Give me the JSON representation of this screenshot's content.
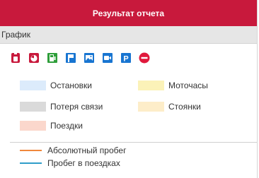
{
  "header": {
    "title": "Результат отчета"
  },
  "section": {
    "title": "График"
  },
  "toolbar": {
    "buttons": [
      {
        "icon": "fuel-canister-icon"
      },
      {
        "icon": "speedometer-icon"
      },
      {
        "icon": "fuel-station-icon"
      },
      {
        "icon": "flag-icon"
      },
      {
        "icon": "image-icon"
      },
      {
        "icon": "video-camera-icon"
      },
      {
        "icon": "parking-icon"
      },
      {
        "icon": "minus-circle-icon"
      }
    ]
  },
  "legend": {
    "stops": {
      "label": "Остановки",
      "color": "#dcebfb"
    },
    "engine_hours": {
      "label": "Моточасы",
      "color": "#fbf2b8"
    },
    "connection_loss": {
      "label": "Потеря связи",
      "color": "#dadada"
    },
    "parkings": {
      "label": "Стоянки",
      "color": "#fdedc9"
    },
    "trips": {
      "label": "Поездки",
      "color": "#fbd7cc"
    }
  },
  "lines": {
    "absolute_mileage": {
      "label": "Абсолютный пробег",
      "color": "#f0883c"
    },
    "trip_mileage": {
      "label": "Пробег в поездках",
      "color": "#2f9dc9"
    }
  },
  "colors": {
    "brand": "#c8193c",
    "icon_blue": "#1875d1",
    "icon_green": "#2e9e3a"
  }
}
